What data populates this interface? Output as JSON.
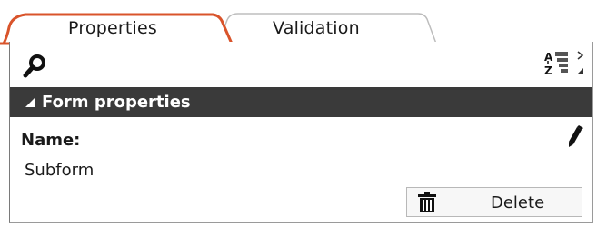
{
  "tabs": [
    {
      "label": "Properties",
      "active": true
    },
    {
      "label": "Validation",
      "active": false
    }
  ],
  "colors": {
    "accent": "#d9542b",
    "section_header_bg": "#3a3a3a"
  },
  "toolbar": {
    "search_icon": "search-icon",
    "sort_icon": "sort-az-icon"
  },
  "section": {
    "title": "Form properties"
  },
  "field": {
    "label": "Name:",
    "value": "Subform"
  },
  "actions": {
    "delete_label": "Delete"
  }
}
